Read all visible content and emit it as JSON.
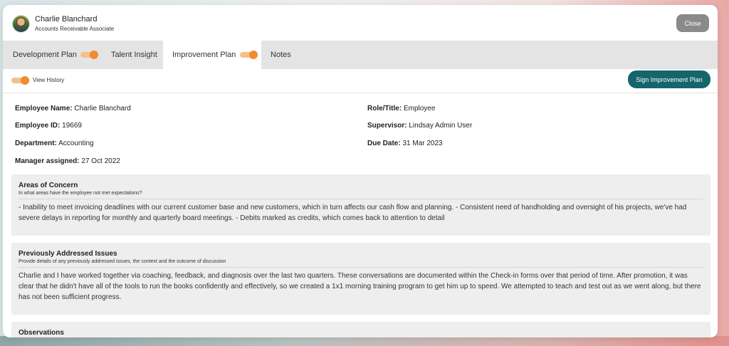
{
  "header": {
    "user_name": "Charlie Blanchard",
    "user_role": "Accounts Receivable Associate",
    "close_label": "Close"
  },
  "tabs": [
    {
      "label": "Development Plan",
      "toggle_on": true
    },
    {
      "label": "Talent Insight"
    },
    {
      "label": "Improvement Plan",
      "toggle_on": true,
      "active": true
    },
    {
      "label": "Notes"
    }
  ],
  "toolbar": {
    "view_history_label": "View History",
    "view_history_on": true,
    "sign_label": "Sign Improvement Plan"
  },
  "employee": {
    "name_label": "Employee Name:",
    "name_value": "Charlie Blanchard",
    "id_label": "Employee ID:",
    "id_value": "19669",
    "department_label": "Department:",
    "department_value": "Accounting",
    "manager_label": "Manager assigned:",
    "manager_value": "27 Oct 2022",
    "role_label": "Role/Title:",
    "role_value": "Employee",
    "supervisor_label": "Supervisor:",
    "supervisor_value": "Lindsay Admin User",
    "due_label": "Due Date:",
    "due_value": "31 Mar 2023"
  },
  "sections": [
    {
      "title": "Areas of Concern",
      "subtitle": "In what areas have the employee not met expectations?",
      "body": "- Inability to meet invoicing deadlines with our current customer base and new customers, which in turn affects our cash flow and planning. - Consistent need of handholding and oversight of his projects, we've had severe delays in reporting for monthly and quarterly board meetings. - Debits marked as credits, which comes back to attention to detail"
    },
    {
      "title": "Previously Addressed Issues",
      "subtitle": "Provide details of any previously addressed issues, the context and the outcome of discussion",
      "body": "Charlie and I have worked together via coaching, feedback, and diagnosis over the last two quarters. These conversations are documented within the Check-in forms over that period of time. After promotion, it was clear that he didn't have all of the tools to run the books confidently and effectively, so we created a 1x1 morning training program to get him up to speed. We attempted to teach and test out as we went along, but there has not been sufficient progress."
    },
    {
      "title": "Observations"
    }
  ],
  "colors": {
    "accent_orange": "#f28a2e",
    "primary_teal": "#15656b",
    "close_gray": "#8a8a8a"
  }
}
